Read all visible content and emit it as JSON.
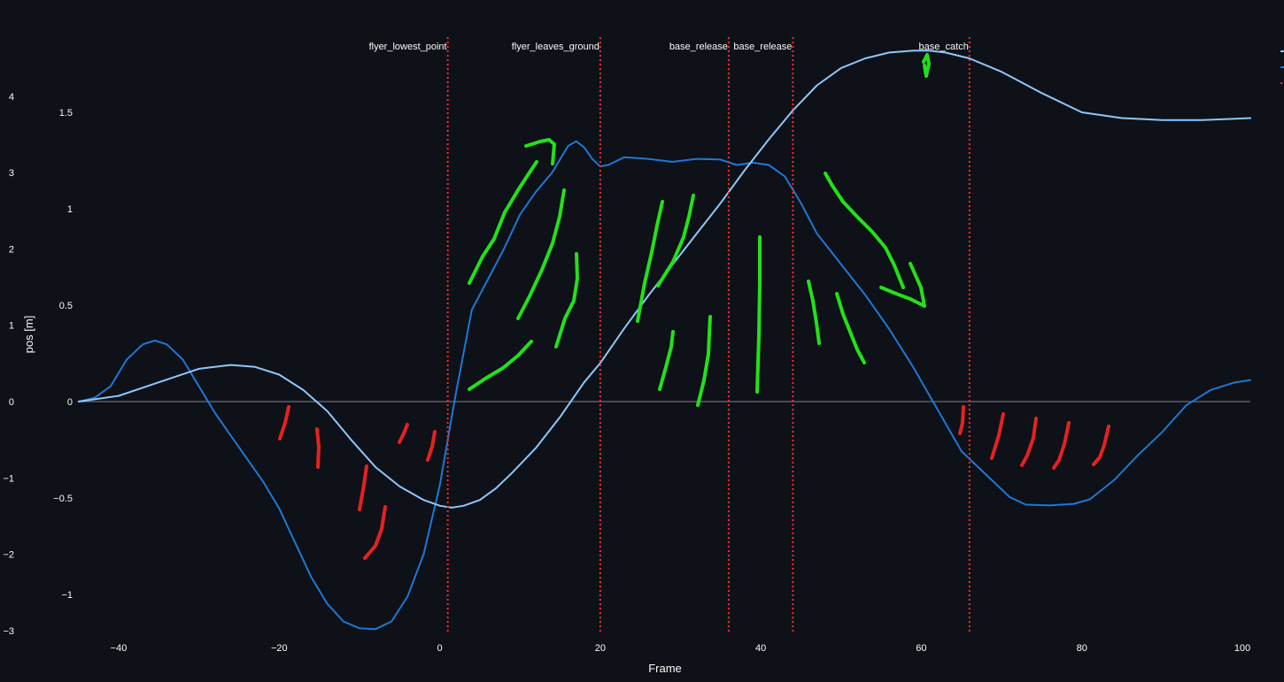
{
  "chart_data": {
    "type": "line",
    "xlabel": "Frame",
    "ylabel": "pos [m]",
    "xlim": [
      -45,
      101
    ],
    "x_ticks": [
      -40,
      -20,
      0,
      20,
      40,
      60,
      80,
      100
    ],
    "ylim_left": [
      -3,
      4.95
    ],
    "y_ticks_left": [
      -3,
      -2,
      -1,
      0,
      1,
      2,
      3,
      4
    ],
    "ylim_right": [
      -1.2,
      1.88
    ],
    "y_ticks_right": [
      -1,
      -0.5,
      0,
      0.5,
      1,
      1.5
    ],
    "grid": false,
    "zero_line": true,
    "legend": "top-right",
    "series": [
      {
        "axis": "left",
        "color": "#1f77d4",
        "x": [
          -45,
          -43,
          -41,
          -39,
          -37,
          -35.5,
          -34,
          -32,
          -30,
          -28,
          -26,
          -24,
          -22,
          -20,
          -18,
          -16,
          -14,
          -12,
          -10,
          -8,
          -6,
          -4,
          -2,
          0,
          2,
          4,
          6,
          8,
          10,
          12,
          14,
          16,
          17,
          18,
          19,
          20,
          21,
          23,
          26,
          29,
          32,
          35,
          37,
          39,
          41,
          43,
          45,
          47,
          50,
          53,
          56,
          59,
          62,
          65,
          68,
          71,
          73,
          76,
          79,
          81,
          84,
          87,
          90,
          93,
          96,
          99,
          101
        ],
        "y": [
          0,
          0.05,
          0.2,
          0.55,
          0.75,
          0.8,
          0.75,
          0.55,
          0.2,
          -0.15,
          -0.45,
          -0.75,
          -1.05,
          -1.4,
          -1.85,
          -2.3,
          -2.65,
          -2.88,
          -2.97,
          -2.98,
          -2.88,
          -2.55,
          -2.0,
          -1.1,
          0.1,
          1.2,
          1.6,
          2.0,
          2.45,
          2.75,
          3.0,
          3.35,
          3.41,
          3.33,
          3.18,
          3.08,
          3.1,
          3.2,
          3.18,
          3.14,
          3.18,
          3.17,
          3.1,
          3.13,
          3.1,
          2.95,
          2.6,
          2.2,
          1.8,
          1.4,
          0.95,
          0.45,
          -0.1,
          -0.65,
          -0.95,
          -1.25,
          -1.35,
          -1.36,
          -1.34,
          -1.28,
          -1.03,
          -0.7,
          -0.4,
          -0.05,
          0.15,
          0.25,
          0.28
        ]
      },
      {
        "axis": "right",
        "color": "#8cc8ff",
        "x": [
          -45,
          -40,
          -35,
          -30,
          -26,
          -23,
          -20,
          -17,
          -14,
          -11,
          -8,
          -5,
          -2,
          0,
          1.5,
          3,
          5,
          7,
          9,
          12,
          15,
          18,
          20,
          23,
          26,
          29,
          32,
          35,
          38,
          41,
          44,
          47,
          50,
          53,
          56,
          59,
          61,
          63,
          66,
          70,
          75,
          80,
          85,
          90,
          95,
          101
        ],
        "y": [
          0,
          0.03,
          0.1,
          0.17,
          0.19,
          0.18,
          0.14,
          0.06,
          -0.05,
          -0.2,
          -0.34,
          -0.44,
          -0.51,
          -0.54,
          -0.55,
          -0.54,
          -0.51,
          -0.45,
          -0.37,
          -0.24,
          -0.08,
          0.1,
          0.2,
          0.38,
          0.55,
          0.71,
          0.87,
          1.03,
          1.2,
          1.36,
          1.51,
          1.64,
          1.73,
          1.78,
          1.81,
          1.82,
          1.82,
          1.81,
          1.78,
          1.71,
          1.6,
          1.5,
          1.47,
          1.46,
          1.46,
          1.47
        ]
      }
    ],
    "events": [
      {
        "frame": 1,
        "label": "flyer_lowest_point"
      },
      {
        "frame": 20,
        "label": "flyer_leaves_ground"
      },
      {
        "frame": 36,
        "label": "base_release"
      },
      {
        "frame": 44,
        "label": "base_release"
      },
      {
        "frame": 66,
        "label": "base_catch"
      }
    ],
    "event_line_color": "#ff2b2b",
    "zero_line_color": "#5a5f6b"
  },
  "annotations": {
    "green_color": "#22e11a",
    "red_color": "#e52222",
    "green_strokes": [
      [
        [
          530,
          320
        ],
        [
          545,
          290
        ],
        [
          558,
          270
        ],
        [
          570,
          240
        ],
        [
          585,
          215
        ],
        [
          598,
          195
        ],
        [
          606,
          183
        ]
      ],
      [
        [
          594,
          165
        ],
        [
          610,
          160
        ],
        [
          620,
          158
        ],
        [
          626,
          163
        ],
        [
          624,
          185
        ]
      ],
      [
        [
          585,
          360
        ],
        [
          598,
          335
        ],
        [
          612,
          305
        ],
        [
          624,
          275
        ],
        [
          632,
          245
        ],
        [
          637,
          215
        ]
      ],
      [
        [
          628,
          392
        ],
        [
          638,
          360
        ],
        [
          648,
          340
        ],
        [
          652,
          315
        ],
        [
          651,
          287
        ]
      ],
      [
        [
          530,
          440
        ],
        [
          548,
          428
        ],
        [
          568,
          416
        ],
        [
          585,
          402
        ],
        [
          600,
          386
        ]
      ],
      [
        [
          720,
          363
        ],
        [
          728,
          320
        ],
        [
          736,
          285
        ],
        [
          742,
          255
        ],
        [
          748,
          228
        ]
      ],
      [
        [
          743,
          323
        ],
        [
          760,
          296
        ],
        [
          772,
          268
        ],
        [
          778,
          245
        ],
        [
          783,
          221
        ]
      ],
      [
        [
          745,
          440
        ],
        [
          752,
          415
        ],
        [
          758,
          392
        ],
        [
          760,
          375
        ]
      ],
      [
        [
          788,
          458
        ],
        [
          795,
          430
        ],
        [
          800,
          400
        ],
        [
          801,
          378
        ],
        [
          802,
          358
        ]
      ],
      [
        [
          855,
          443
        ],
        [
          857,
          380
        ],
        [
          858,
          320
        ],
        [
          858,
          268
        ]
      ],
      [
        [
          932,
          196
        ],
        [
          940,
          210
        ],
        [
          952,
          228
        ],
        [
          968,
          245
        ],
        [
          985,
          262
        ],
        [
          1000,
          280
        ],
        [
          1010,
          300
        ],
        [
          1020,
          325
        ]
      ],
      [
        [
          995,
          325
        ],
        [
          1012,
          332
        ],
        [
          1028,
          338
        ],
        [
          1044,
          346
        ],
        [
          1040,
          325
        ],
        [
          1028,
          298
        ]
      ],
      [
        [
          913,
          318
        ],
        [
          918,
          340
        ],
        [
          922,
          365
        ],
        [
          925,
          388
        ]
      ],
      [
        [
          945,
          332
        ],
        [
          952,
          355
        ],
        [
          960,
          375
        ],
        [
          968,
          395
        ],
        [
          976,
          410
        ]
      ],
      [
        [
          1043,
          70
        ],
        [
          1047,
          62
        ],
        [
          1049,
          72
        ],
        [
          1046,
          86
        ],
        [
          1044,
          74
        ]
      ]
    ],
    "red_strokes": [
      [
        [
          326,
          460
        ],
        [
          322,
          478
        ],
        [
          316,
          496
        ]
      ],
      [
        [
          358,
          485
        ],
        [
          360,
          505
        ],
        [
          359,
          528
        ]
      ],
      [
        [
          414,
          527
        ],
        [
          411,
          548
        ],
        [
          406,
          576
        ]
      ],
      [
        [
          435,
          573
        ],
        [
          431,
          598
        ],
        [
          424,
          617
        ],
        [
          412,
          631
        ]
      ],
      [
        [
          460,
          480
        ],
        [
          456,
          490
        ],
        [
          451,
          500
        ]
      ],
      [
        [
          491,
          488
        ],
        [
          488,
          505
        ],
        [
          483,
          520
        ]
      ],
      [
        [
          1088,
          460
        ],
        [
          1087,
          478
        ],
        [
          1084,
          490
        ]
      ],
      [
        [
          1133,
          468
        ],
        [
          1128,
          492
        ],
        [
          1120,
          518
        ]
      ],
      [
        [
          1170,
          473
        ],
        [
          1167,
          495
        ],
        [
          1160,
          515
        ],
        [
          1154,
          526
        ]
      ],
      [
        [
          1207,
          478
        ],
        [
          1202,
          502
        ],
        [
          1196,
          520
        ],
        [
          1190,
          529
        ]
      ],
      [
        [
          1252,
          482
        ],
        [
          1247,
          503
        ],
        [
          1242,
          517
        ],
        [
          1235,
          525
        ]
      ]
    ]
  }
}
